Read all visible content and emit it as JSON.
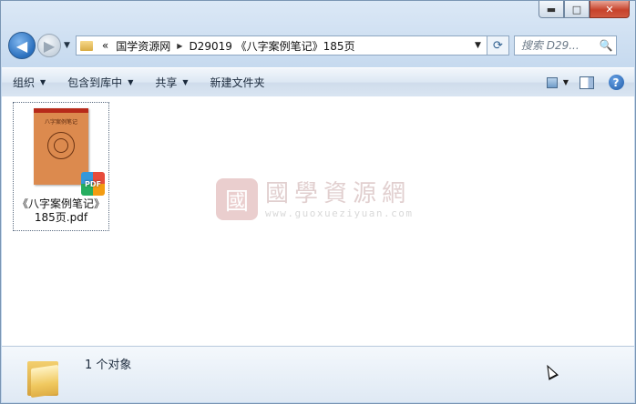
{
  "window": {
    "caption_buttons": {
      "minimize": "▬",
      "maximize": "□",
      "close": "✕"
    }
  },
  "nav": {
    "back_icon": "◀",
    "forward_icon": "▶",
    "history_dropdown": "▼"
  },
  "address": {
    "overflow": "«",
    "breadcrumbs": [
      "国学资源网",
      "D29019 《八字案例笔记》185页"
    ],
    "separator": "▶",
    "dropdown": "▼",
    "refresh_icon": "⟳"
  },
  "search": {
    "placeholder": "搜索 D29...",
    "icon": "🔍"
  },
  "toolbar": {
    "organize": "组织",
    "include_library": "包含到库中",
    "share": "共享",
    "new_folder": "新建文件夹",
    "help": "?"
  },
  "file": {
    "name": "《八字案例笔记》185页.pdf",
    "book_title": "八字案例笔记",
    "badge": "PDF"
  },
  "watermark": {
    "seal": "國",
    "name": "國學資源網",
    "url": "www.guoxueziyuan.com"
  },
  "status": {
    "count_text": "1 个对象"
  },
  "colors": {
    "accent": "#2a6fbd",
    "toolbar_bg": "#dce7f3",
    "close_red": "#c7422b"
  }
}
